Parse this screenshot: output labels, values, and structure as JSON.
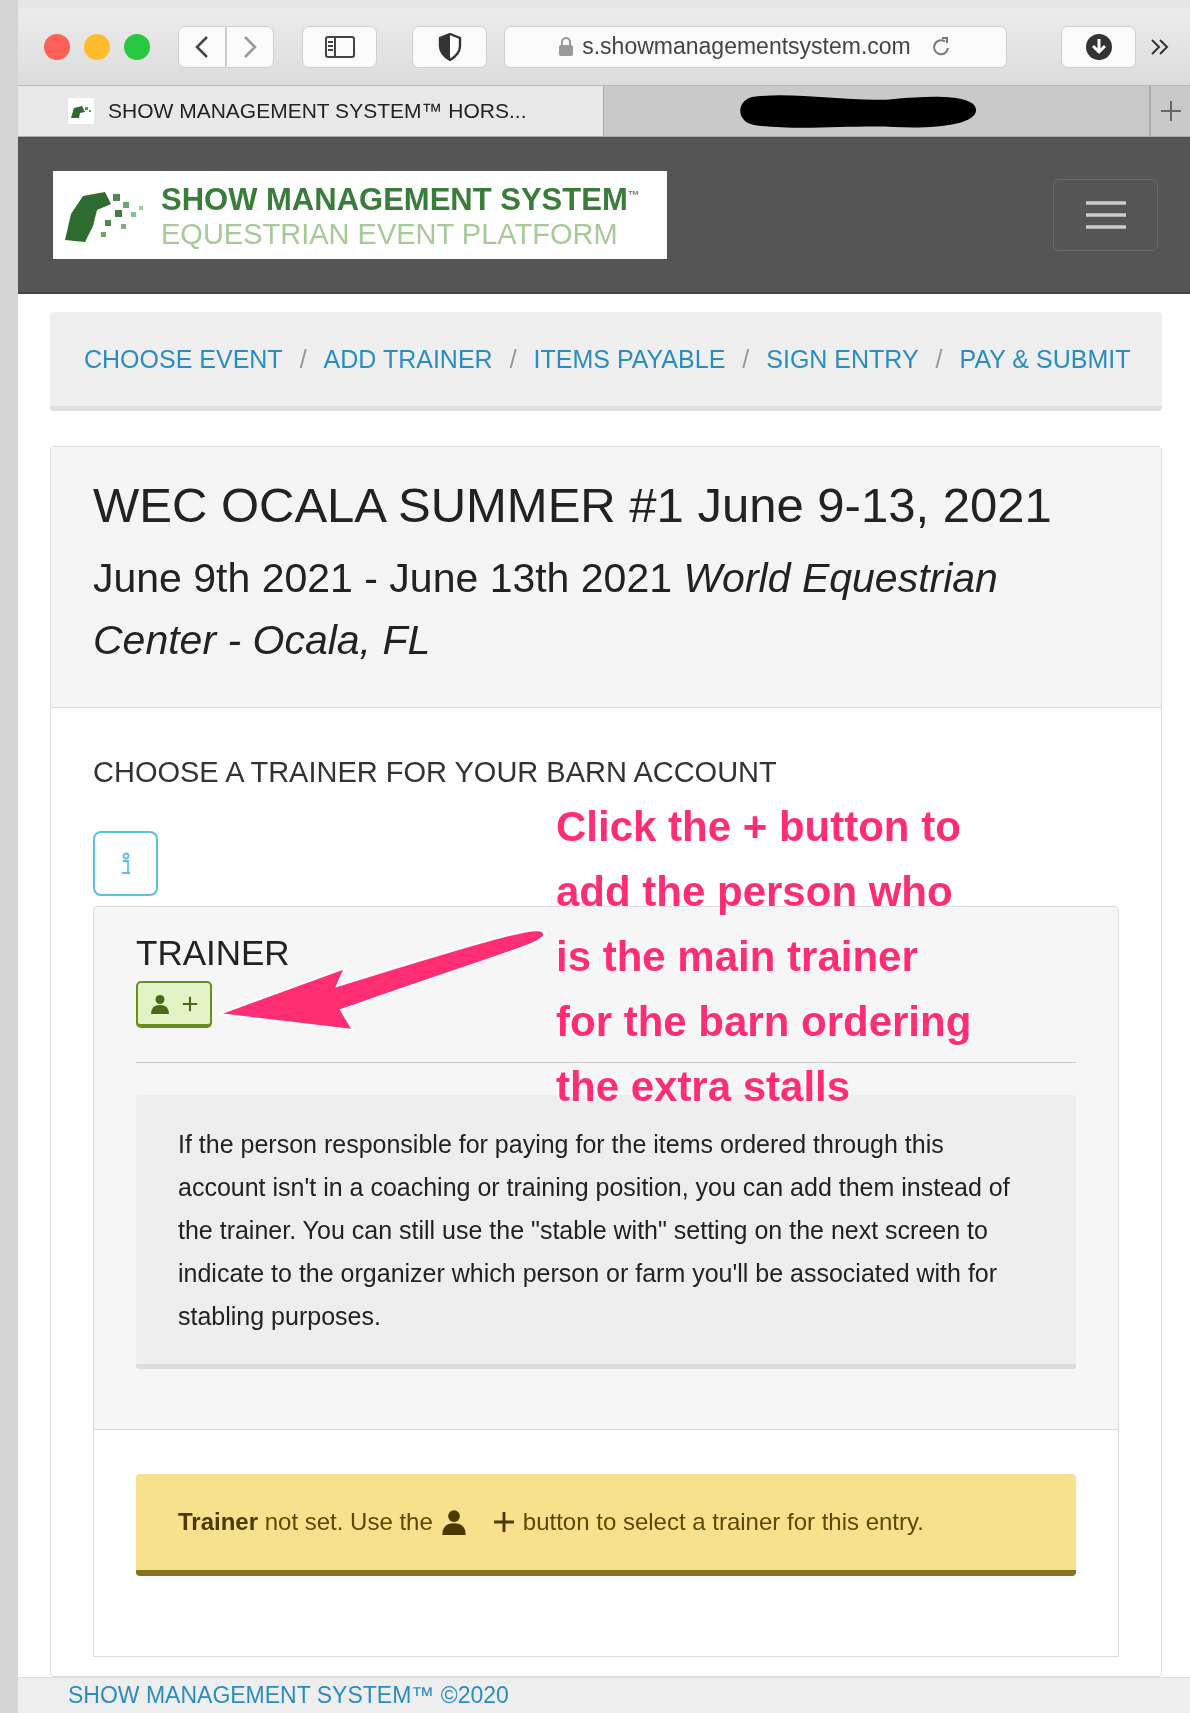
{
  "browser": {
    "url": "s.showmanagementsystem.com",
    "tabs": [
      {
        "title": "SHOW MANAGEMENT SYSTEM™ HORS...",
        "selected": true,
        "redacted": false
      },
      {
        "selected": false,
        "redacted": true
      }
    ]
  },
  "header": {
    "logo_title": "SHOW MANAGEMENT SYSTEM",
    "logo_mark": "™",
    "logo_subtitle": "EQUESTRIAN EVENT PLATFORM"
  },
  "breadcrumb": {
    "items": [
      {
        "label": "CHOOSE EVENT"
      },
      {
        "label": "ADD TRAINER"
      },
      {
        "label": "ITEMS PAYABLE"
      },
      {
        "label": "SIGN ENTRY"
      },
      {
        "label": "PAY & SUBMIT"
      }
    ],
    "separators": [
      "/",
      "/",
      "/",
      "/"
    ]
  },
  "event": {
    "title": "WEC OCALA SUMMER #1 June 9-13, 2021",
    "subtitle": "June 9th 2021 - June 13th 2021 *World Equestrian Center - Ocala, FL*"
  },
  "section_title": "CHOOSE A TRAINER FOR YOUR BARN ACCOUNT",
  "trainer_panel": {
    "heading": "TRAINER",
    "note": "If the person responsible for paying for the items ordered through this account isn't in a coaching or training position, you can add them instead of the trainer. You can still use the \"stable with\" setting on the next screen to indicate to the organizer which person or farm you'll be associated with for stabling purposes."
  },
  "alert": {
    "text_before": "**Trainer** not set. Use the",
    "text_after": "button to select a trainer for this entry."
  },
  "annotation": {
    "text": "Click the + button to add the person who is the main trainer for the barn ordering the extra stalls"
  },
  "footer": {
    "text": "SHOW MANAGEMENT SYSTEM™ ©2020"
  }
}
